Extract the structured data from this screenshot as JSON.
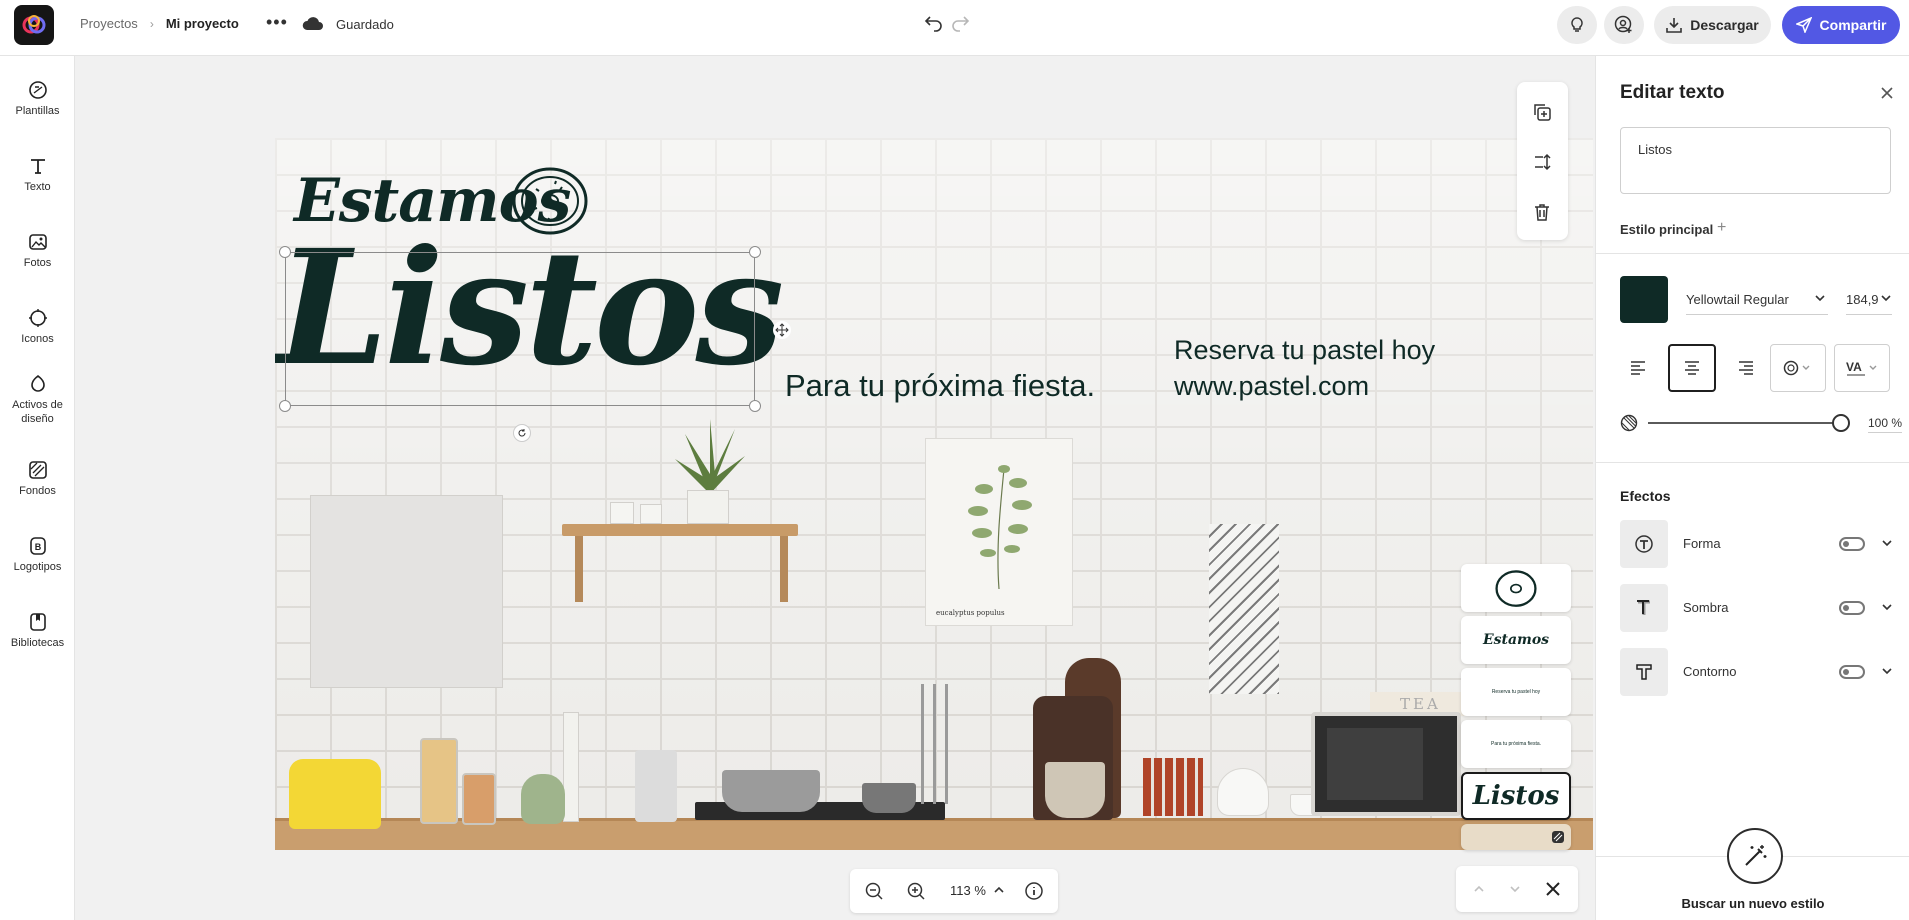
{
  "topbar": {
    "breadcrumb_root": "Proyectos",
    "project_name": "Mi proyecto",
    "more_label": "•••",
    "save_status": "Guardado",
    "download_label": "Descargar",
    "share_label": "Compartir",
    "share_color": "#5258e4"
  },
  "sidebar": {
    "items": [
      {
        "label": "Plantillas",
        "icon": "templates-icon"
      },
      {
        "label": "Texto",
        "icon": "text-icon"
      },
      {
        "label": "Fotos",
        "icon": "photos-icon"
      },
      {
        "label": "Iconos",
        "icon": "icons-icon"
      },
      {
        "label": "Activos de diseño",
        "icon": "design-assets-icon"
      },
      {
        "label": "Fondos",
        "icon": "backgrounds-icon"
      },
      {
        "label": "Logotipos",
        "icon": "logos-icon"
      },
      {
        "label": "Bibliotecas",
        "icon": "libraries-icon"
      }
    ]
  },
  "design": {
    "headline_small": "Estamos",
    "headline_big": "Listos",
    "tagline": "Para tu próxima fiesta.",
    "cta_line1": "Reserva tu pastel hoy",
    "cta_line2": "www.pastel.com",
    "poster_caption": "eucalyptus populus",
    "teabox_text": "TEA",
    "text_color": "#0f2a26"
  },
  "layers": {
    "items": [
      {
        "label": "",
        "kind": "donut"
      },
      {
        "label": "Estamos",
        "kind": "text"
      },
      {
        "label": "Reserva tu pastel hoy",
        "kind": "small-text"
      },
      {
        "label": "Para tu próxima fiesta.",
        "kind": "small-text"
      },
      {
        "label": "Listos",
        "kind": "text",
        "selected": true
      },
      {
        "label": "",
        "kind": "photo"
      }
    ]
  },
  "zoom": {
    "value": "113 %"
  },
  "panel": {
    "title": "Editar texto",
    "text_value": "Listos",
    "main_style_label": "Estilo principal",
    "font_name": "Yellowtail Regular",
    "font_size": "184,9",
    "swatch_color": "#0f2a26",
    "opacity_value": "100 %",
    "opacity_fraction": 1.0,
    "effects_title": "Efectos",
    "effects": [
      {
        "label": "Forma",
        "enabled": false
      },
      {
        "label": "Sombra",
        "enabled": false
      },
      {
        "label": "Contorno",
        "enabled": false
      }
    ],
    "find_style_label": "Buscar un nuevo estilo"
  }
}
